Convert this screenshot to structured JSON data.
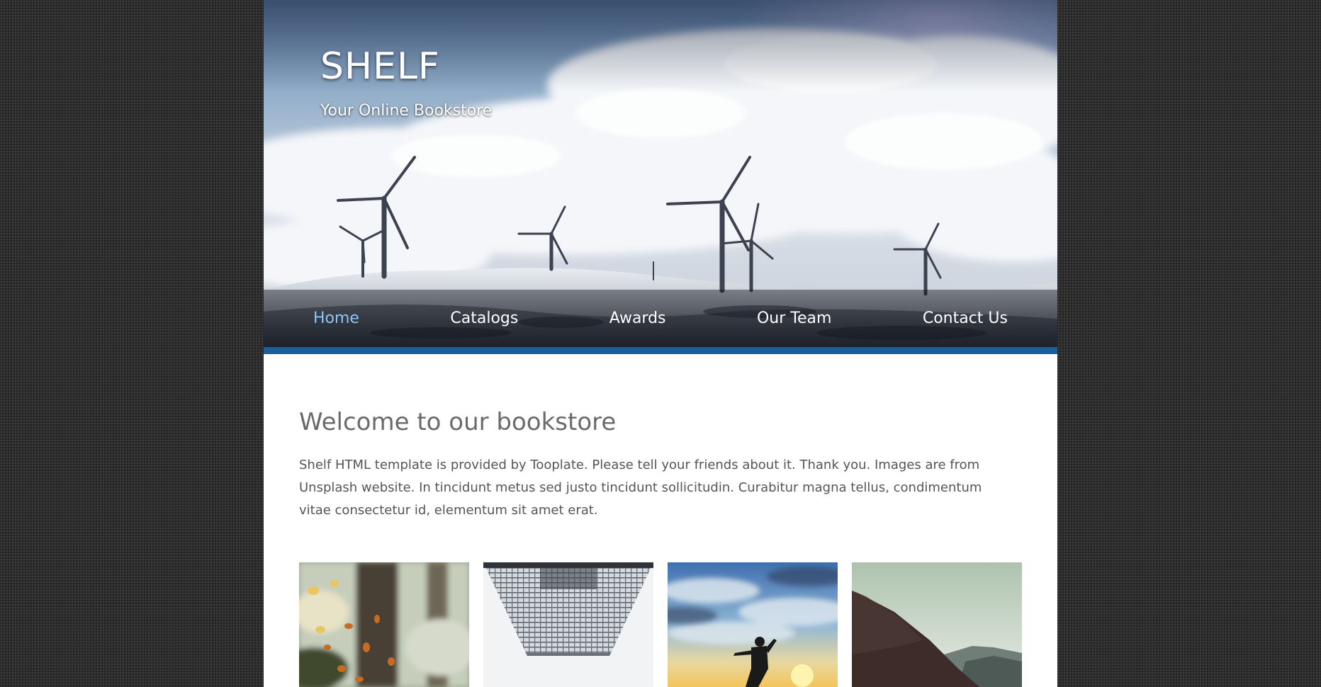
{
  "site": {
    "title": "SHELF",
    "tagline": "Your Online Bookstore"
  },
  "nav": {
    "items": [
      {
        "label": "Home",
        "active": true
      },
      {
        "label": "Catalogs",
        "active": false
      },
      {
        "label": "Awards",
        "active": false
      },
      {
        "label": "Our Team",
        "active": false
      },
      {
        "label": "Contact Us",
        "active": false
      }
    ]
  },
  "main": {
    "heading": "Welcome to our bookstore",
    "intro": "Shelf HTML template is provided by Tooplate. Please tell your friends about it. Thank you. Images are from Unsplash website. In tincidunt metus sed justo tincidunt sollicitudin. Curabitur magna tellus, condimentum vitae consectetur id, elementum sit amet erat."
  },
  "colors": {
    "nav_active": "#8fc4f5",
    "accent_bar": "#1a5f9e",
    "page_background": "#2f2f2f"
  }
}
